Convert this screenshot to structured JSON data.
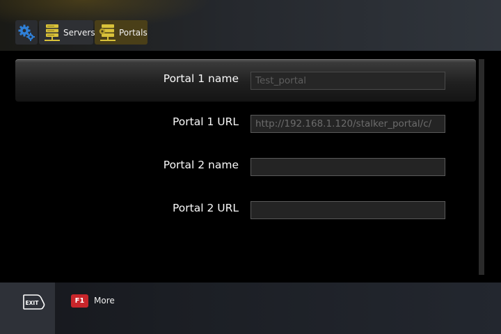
{
  "header": {
    "breadcrumbs": [
      {
        "label": "",
        "icon": "gears-icon",
        "color": "#2f7fd6"
      },
      {
        "label": "Servers",
        "icon": "server-icon",
        "color": "#d9c23a"
      },
      {
        "label": "Portals",
        "icon": "portal-server-icon",
        "color": "#d9c23a"
      }
    ]
  },
  "settings": {
    "rows": [
      {
        "label": "Portal 1 name",
        "value": "Test_portal",
        "selected": true
      },
      {
        "label": "Portal 1 URL",
        "value": "http://192.168.1.120/stalker_portal/c/",
        "selected": false
      },
      {
        "label": "Portal 2 name",
        "value": "",
        "selected": false
      },
      {
        "label": "Portal 2 URL",
        "value": "",
        "selected": false
      }
    ]
  },
  "footer": {
    "exit_label": "EXIT",
    "f1_key": "F1",
    "more_label": "More",
    "f1_color": "#c8262b"
  }
}
